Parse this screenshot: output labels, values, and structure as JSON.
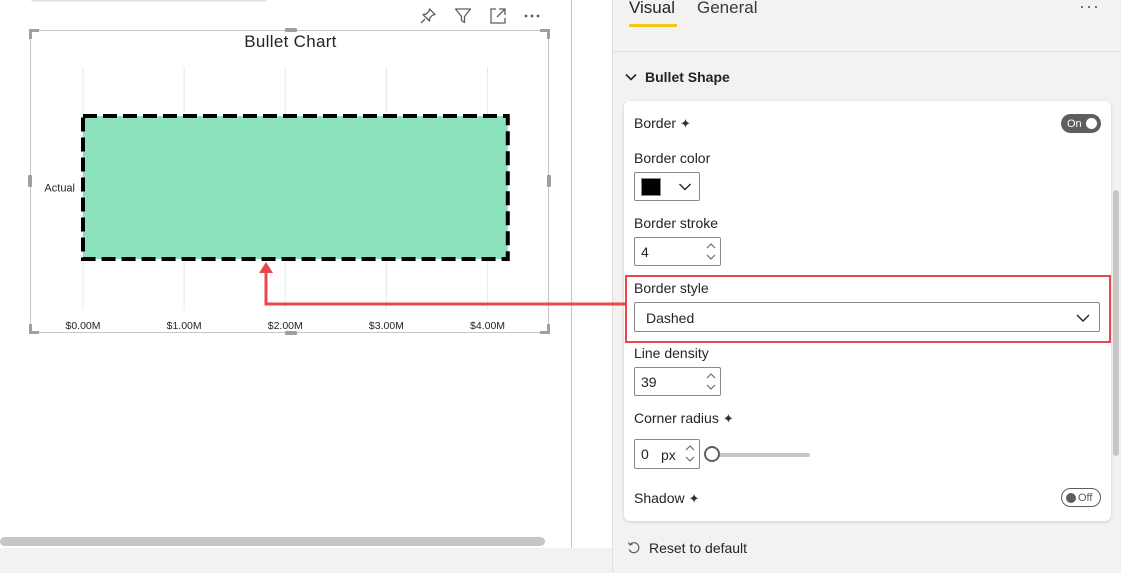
{
  "chart_data": {
    "type": "bar",
    "title": "Bullet Chart",
    "categories": [
      "Actual"
    ],
    "values": [
      4.2
    ],
    "x_tick_labels": [
      "$0.00M",
      "$1.00M",
      "$2.00M",
      "$3.00M",
      "$4.00M"
    ],
    "x_ticks": [
      0,
      1,
      2,
      3,
      4
    ],
    "xlim": [
      0,
      4.4
    ],
    "orientation": "horizontal",
    "bar_fill": "#8de2be",
    "bar_border_color": "#000000",
    "bar_border_style": "dashed",
    "grid": true
  },
  "pane": {
    "tabs": {
      "visual": "Visual",
      "general": "General"
    },
    "more": "···",
    "section_title": "Bullet Shape",
    "border": {
      "label": "Border",
      "sparkle": "✦",
      "toggle": "On"
    },
    "border_color": {
      "label": "Border color",
      "value": "#000000"
    },
    "border_stroke": {
      "label": "Border stroke",
      "value": "4"
    },
    "border_style": {
      "label": "Border style",
      "value": "Dashed"
    },
    "line_density": {
      "label": "Line density",
      "value": "39"
    },
    "corner_radius": {
      "label": "Corner radius",
      "sparkle": "✦",
      "value": "0",
      "unit": "px",
      "slider_fraction": 0
    },
    "shadow": {
      "label": "Shadow",
      "sparkle": "✦",
      "toggle": "Off"
    },
    "reset": "Reset to default"
  },
  "colors": {
    "accent_tab": "#f2c811",
    "annotation_red": "#e8474d",
    "pane_bg": "#f3f2f1"
  },
  "icons": {
    "header": [
      "pin-icon",
      "filter-icon",
      "focus-mode-icon",
      "more-options-icon"
    ]
  }
}
